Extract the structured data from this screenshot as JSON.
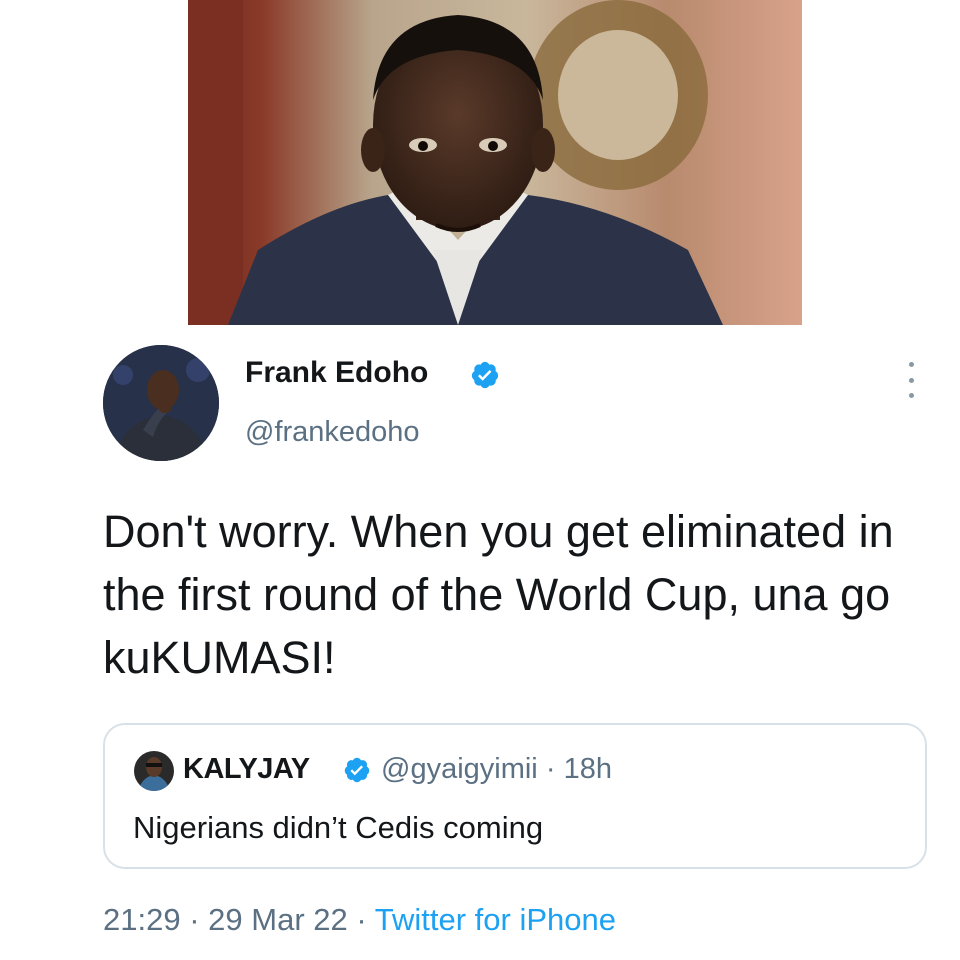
{
  "author": {
    "name": "Frank Edoho",
    "handle": "@frankedoho",
    "verified": true
  },
  "tweet": {
    "text": "Don't worry. When you get eliminated in the first round of the World Cup, una go kuKUMASI!",
    "time": "21:29",
    "date": "29 Mar 22",
    "source": "Twitter for iPhone",
    "separator": "·"
  },
  "quoted": {
    "name": "KALYJAY",
    "handle": "@gyaigyimii",
    "age": "18h",
    "separator": "·",
    "verified": true,
    "text": "Nigerians didn’t Cedis coming"
  },
  "icons": {
    "verified": "verified-badge-icon",
    "more": "more-options-icon"
  },
  "colors": {
    "verified_blue": "#1da1f2",
    "link_blue": "#1da1f2",
    "secondary_text": "#5b7083",
    "border": "#d9e1e8"
  }
}
